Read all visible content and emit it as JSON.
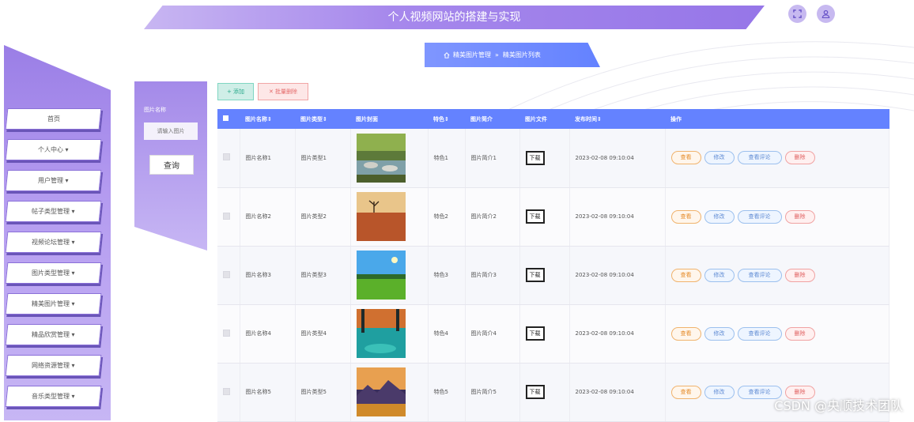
{
  "header": {
    "title": "个人视频网站的搭建与实现"
  },
  "breadcrumb": {
    "parent": "精美图片管理",
    "separator": "»",
    "current": "精美图片列表"
  },
  "sidebar": {
    "items": [
      {
        "label": "首页"
      },
      {
        "label": "个人中心 ▾"
      },
      {
        "label": "用户管理 ▾"
      },
      {
        "label": "帖子类型管理 ▾"
      },
      {
        "label": "视频论坛管理 ▾"
      },
      {
        "label": "图片类型管理 ▾"
      },
      {
        "label": "精美图片管理 ▾"
      },
      {
        "label": "精品欣赏管理 ▾"
      },
      {
        "label": "网络资源管理 ▾"
      },
      {
        "label": "音乐类型管理 ▾"
      }
    ]
  },
  "filter": {
    "label": "图片名称",
    "placeholder": "请输入图片",
    "query_button": "查询"
  },
  "toolbar": {
    "add_label": "+ 添加",
    "batch_delete_label": "✕ 批量删除"
  },
  "table": {
    "columns": [
      "图片名称⇕",
      "图片类型⇕",
      "图片封面",
      "特色⇕",
      "图片简介",
      "图片文件",
      "发布时间⇕",
      "操作"
    ],
    "rows": [
      {
        "name": "图片名称1",
        "type": "图片类型1",
        "feature": "特色1",
        "intro": "图片简介1",
        "file_btn": "下载",
        "time": "2023-02-08 09:10:04"
      },
      {
        "name": "图片名称2",
        "type": "图片类型2",
        "feature": "特色2",
        "intro": "图片简介2",
        "file_btn": "下载",
        "time": "2023-02-08 09:10:04"
      },
      {
        "name": "图片名称3",
        "type": "图片类型3",
        "feature": "特色3",
        "intro": "图片简介3",
        "file_btn": "下载",
        "time": "2023-02-08 09:10:04"
      },
      {
        "name": "图片名称4",
        "type": "图片类型4",
        "feature": "特色4",
        "intro": "图片简介4",
        "file_btn": "下载",
        "time": "2023-02-08 09:10:04"
      },
      {
        "name": "图片名称5",
        "type": "图片类型5",
        "feature": "特色5",
        "intro": "图片简介5",
        "file_btn": "下载",
        "time": "2023-02-08 09:10:04"
      }
    ],
    "actions": {
      "view": "查看",
      "edit": "修改",
      "comments": "查看评论",
      "delete": "删除"
    }
  },
  "watermark": "CSDN @央顺技术团队",
  "colors": {
    "accent": "#6482ff",
    "sidebar": "#a688ec"
  }
}
